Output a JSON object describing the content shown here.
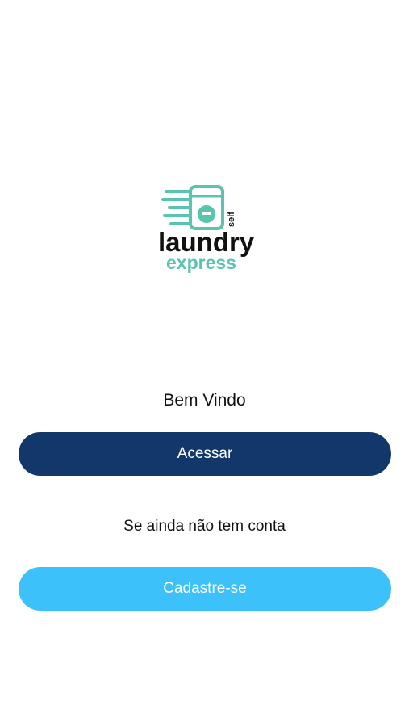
{
  "logo": {
    "icon": "washing-machine-icon",
    "self_text": "self",
    "laundry_text": "laundry",
    "express_text": "express",
    "brand_color": "#5bc4b0",
    "text_color": "#111111"
  },
  "welcome": {
    "title": "Bem Vindo"
  },
  "actions": {
    "login_label": "Acessar",
    "signup_hint": "Se ainda não tem conta",
    "signup_label": "Cadastre-se"
  },
  "colors": {
    "login_button": "#12376b",
    "signup_button": "#3dc1fb"
  }
}
